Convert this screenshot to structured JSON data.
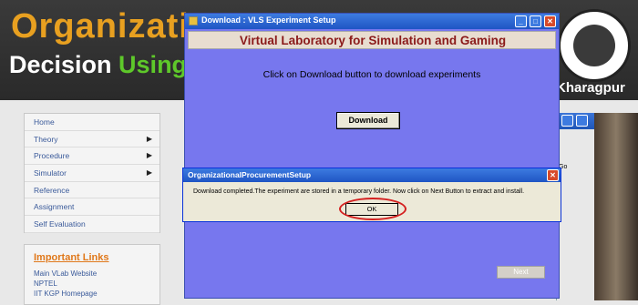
{
  "background_page": {
    "title_line1": "Organizatio",
    "title_line2_a": "Decision ",
    "title_line2_b": "Using",
    "institute": "Kharagpur",
    "nav": [
      {
        "label": "Home",
        "has_arrow": false
      },
      {
        "label": "Theory",
        "has_arrow": true
      },
      {
        "label": "Procedure",
        "has_arrow": true
      },
      {
        "label": "Simulator",
        "has_arrow": true
      },
      {
        "label": "Reference",
        "has_arrow": false
      },
      {
        "label": "Assignment",
        "has_arrow": false
      },
      {
        "label": "Self Evaluation",
        "has_arrow": false
      }
    ],
    "important_links_title": "Important Links",
    "links": [
      "Main VLab Website",
      "NPTEL",
      "IIT KGP Homepage"
    ],
    "partial_window_go": "Go"
  },
  "main_window": {
    "title": "Download  : VLS Experiment Setup",
    "heading": "Virtual Laboratory for Simulation and Gaming",
    "instruction": "Click on Download button to download experiments",
    "download_label": "Download",
    "next_label": "Next"
  },
  "message_box": {
    "title": "OrganizationalProcurementSetup",
    "message": "Download completed.The experiment are stored in a temporary folder. Now click on Next Button to extract and install.",
    "ok_label": "OK"
  },
  "colors": {
    "window_body": "#7777ee",
    "heading_text": "#8b1a1a",
    "highlight": "#d42020"
  }
}
